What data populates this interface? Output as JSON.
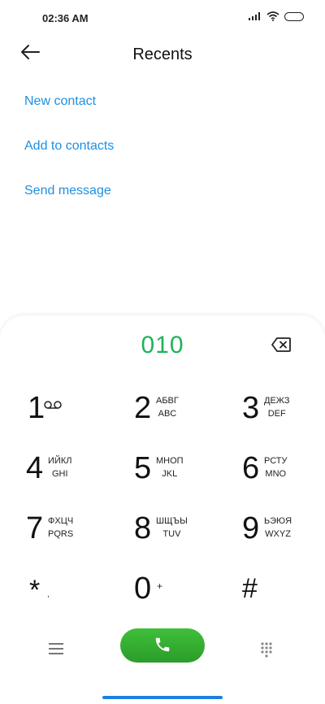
{
  "status_bar": {
    "time": "02:36 AM"
  },
  "header": {
    "title": "Recents"
  },
  "actions": [
    {
      "label": "New contact"
    },
    {
      "label": "Add to contacts"
    },
    {
      "label": "Send message"
    }
  ],
  "dialer": {
    "number": "010",
    "keys": [
      {
        "digit": "1",
        "line1": "",
        "line2": ""
      },
      {
        "digit": "2",
        "line1": "АБВГ",
        "line2": "ABC"
      },
      {
        "digit": "3",
        "line1": "ДЕЖЗ",
        "line2": "DEF"
      },
      {
        "digit": "4",
        "line1": "ИЙКЛ",
        "line2": "GHI"
      },
      {
        "digit": "5",
        "line1": "МНОП",
        "line2": "JKL"
      },
      {
        "digit": "6",
        "line1": "РСТУ",
        "line2": "MNO"
      },
      {
        "digit": "7",
        "line1": "ФХЦЧ",
        "line2": "PQRS"
      },
      {
        "digit": "8",
        "line1": "ШЩЪЫ",
        "line2": "TUV"
      },
      {
        "digit": "9",
        "line1": "ЬЭЮЯ",
        "line2": "WXYZ"
      }
    ],
    "star": "*",
    "zero": "0",
    "zero_sub": "+",
    "hash": "#"
  },
  "colors": {
    "accent": "#1f8fe2",
    "number": "#1fb35a",
    "call": "#2fa62d"
  },
  "icons": [
    "back-arrow-icon",
    "backspace-icon",
    "voicemail-icon",
    "menu-icon",
    "phone-icon",
    "dialpad-grid-icon"
  ]
}
